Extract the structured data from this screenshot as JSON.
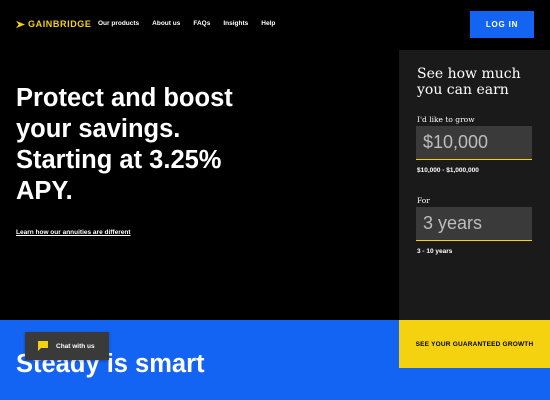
{
  "brand": {
    "name": "GAINBRIDGE",
    "logo_icon": "chevron-arrow-icon",
    "accent": "#f5d20f"
  },
  "nav": {
    "items": [
      {
        "label": "Our products"
      },
      {
        "label": "About us"
      },
      {
        "label": "FAQs"
      },
      {
        "label": "Insights"
      },
      {
        "label": "Help"
      }
    ],
    "login_label": "LOG IN",
    "login_color": "#1464f4"
  },
  "hero": {
    "title": "Protect and boost your savings. Starting at 3.25% APY.",
    "link": "Learn how our annuities are different"
  },
  "calculator": {
    "title": "See how much you can earn",
    "grow_label": "I'd like to grow",
    "grow_value": "$10,000",
    "grow_range": "$10,000 - $1,000,000",
    "for_label": "For",
    "years_value": "3 years",
    "years_range": "3 - 10 years"
  },
  "band": {
    "title": "Steady is smart",
    "cta_label": "SEE YOUR GUARANTEED GROWTH",
    "color": "#1464f4"
  },
  "chat": {
    "label": "Chat with us",
    "icon": "chat-bubble-icon"
  }
}
